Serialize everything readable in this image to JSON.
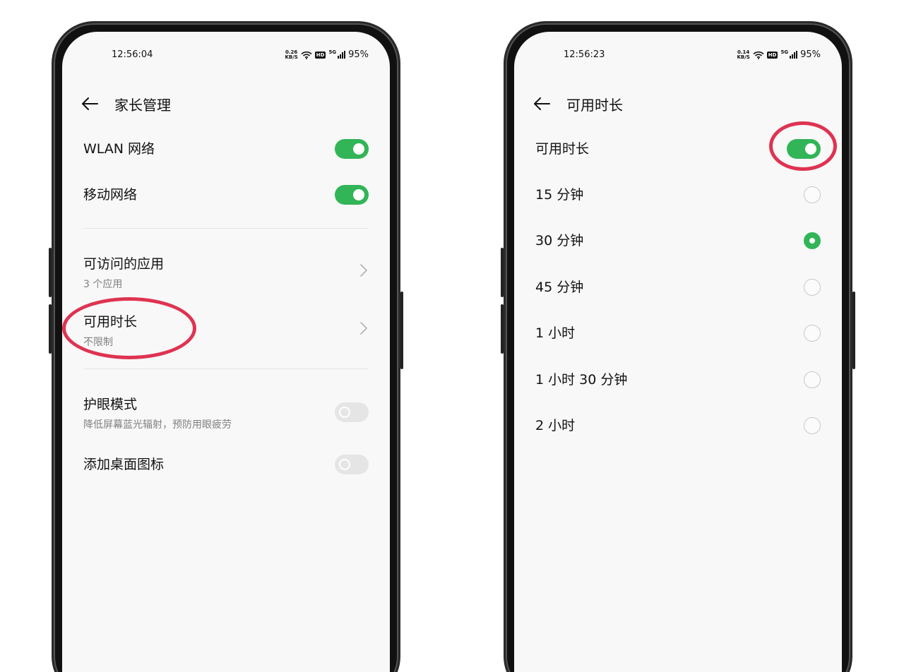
{
  "left_phone": {
    "status": {
      "time": "12:56:04",
      "net_speed_value": "0.26",
      "net_speed_unit": "KB/S",
      "hd_label": "HD",
      "net_type": "5G",
      "battery": "95%"
    },
    "header": {
      "title": "家长管理"
    },
    "settings": {
      "wlan": {
        "label": "WLAN 网络",
        "enabled": true
      },
      "mobile": {
        "label": "移动网络",
        "enabled": true
      },
      "apps": {
        "label": "可访问的应用",
        "sub": "3 个应用"
      },
      "time_limit": {
        "label": "可用时长",
        "sub": "不限制"
      },
      "eye_mode": {
        "label": "护眼模式",
        "sub": "降低屏幕蓝光辐射，预防用眼疲劳",
        "enabled": false
      },
      "desktop_icon": {
        "label": "添加桌面图标",
        "enabled": false
      }
    }
  },
  "right_phone": {
    "status": {
      "time": "12:56:23",
      "net_speed_value": "0.14",
      "net_speed_unit": "KB/S",
      "hd_label": "HD",
      "net_type": "5G",
      "battery": "95%"
    },
    "header": {
      "title": "可用时长"
    },
    "master_toggle": {
      "label": "可用时长",
      "enabled": true
    },
    "options": [
      {
        "label": "15 分钟",
        "selected": false
      },
      {
        "label": "30 分钟",
        "selected": true
      },
      {
        "label": "45 分钟",
        "selected": false
      },
      {
        "label": "1 小时",
        "selected": false
      },
      {
        "label": "1 小时 30 分钟",
        "selected": false
      },
      {
        "label": "2 小时",
        "selected": false
      }
    ]
  },
  "colors": {
    "accent": "#31b557",
    "highlight": "#df3351",
    "toggle_off": "#e5e5e5"
  }
}
